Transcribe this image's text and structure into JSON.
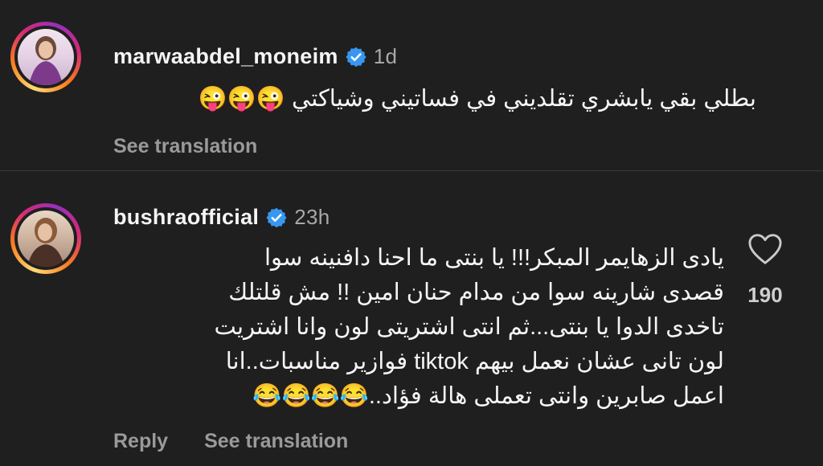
{
  "comments": [
    {
      "username": "marwaabdel_moneim",
      "time": "1d",
      "text_lines": [
        "بطلي بقي يابشري تقلديني في فساتيني وشياكتي 😜😜😜"
      ],
      "actions": [
        "See translation"
      ]
    },
    {
      "username": "bushraofficial",
      "time": "23h",
      "text_lines": [
        "يادى الزهايمر المبكر!!! يا بنتى ما احنا دافنينه سوا",
        "قصدى شارينه سوا من مدام حنان امين !! مش قلتلك",
        "تاخدى الدوا يا بنتى...ثم انتى اشتريتى لون وانا اشتريت",
        "لون تانى عشان نعمل بيهم tiktok فوازير مناسبات..انا",
        "اعمل صابرين وانتى تعملى هالة فؤاد..😂😂😂😂"
      ],
      "actions": [
        "Reply",
        "See translation"
      ],
      "like_count": "190"
    }
  ],
  "colors": {
    "background": "#1f1f1f",
    "verified": "#3897f0",
    "muted": "#a8a8a8"
  },
  "icons": [
    "verified-badge-icon",
    "heart-icon"
  ]
}
